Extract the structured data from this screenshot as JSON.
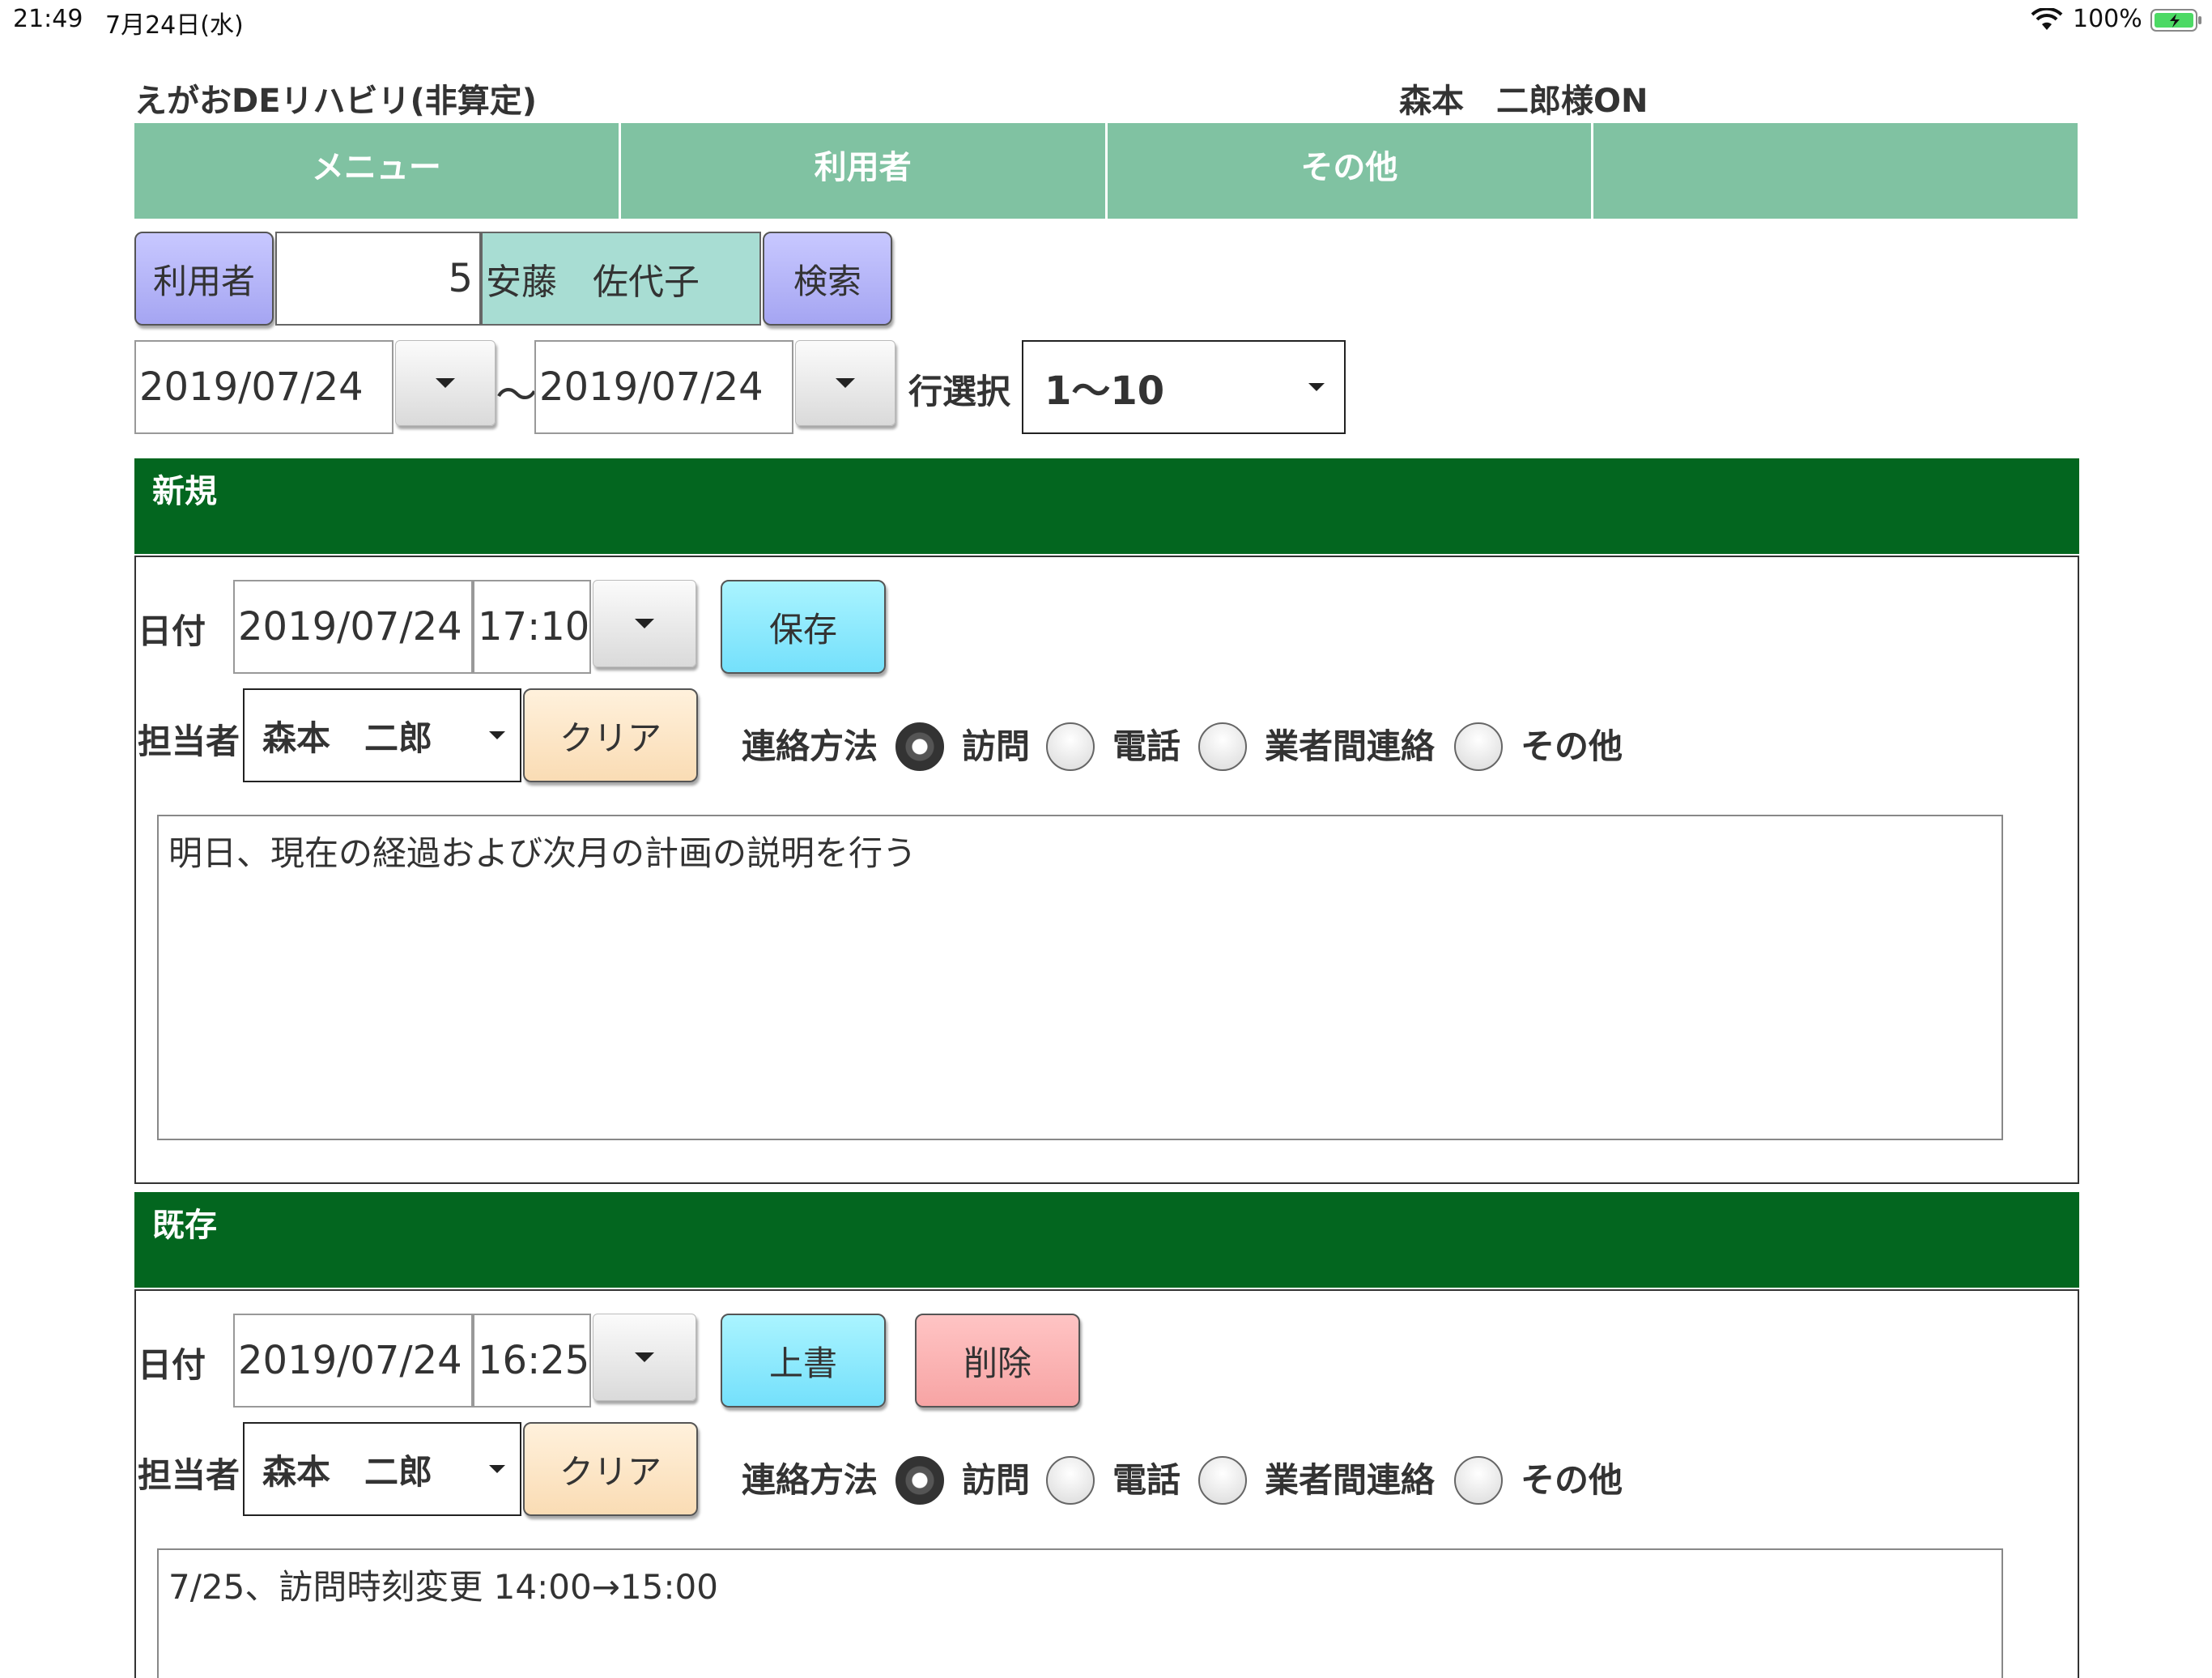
{
  "status_bar": {
    "time": "21:49",
    "date": "7月24日(水)",
    "battery": "100%"
  },
  "header": {
    "app_title": "えがおDEリハビリ(非算定)",
    "user_status": "森本　二郎様ON"
  },
  "tabs": [
    "メニュー",
    "利用者",
    "その他",
    ""
  ],
  "search": {
    "user_button": "利用者",
    "user_id": "5",
    "user_name": "安藤　佐代子",
    "search_button": "検索",
    "date_from": "2019/07/24",
    "tilde": "〜",
    "date_to": "2019/07/24",
    "row_select_label": "行選択",
    "row_select_value": "1〜10"
  },
  "new_section": {
    "title": "新規",
    "date_label": "日付",
    "date": "2019/07/24",
    "time": "17:10",
    "save_button": "保存",
    "staff_label": "担当者",
    "staff": "森本　二郎",
    "clear_button": "クリア",
    "contact_label": "連絡方法",
    "contact_options": [
      "訪問",
      "電話",
      "業者間連絡",
      "その他"
    ],
    "memo": "明日、現在の経過および次月の計画の説明を行う"
  },
  "existing_section": {
    "title": "既存",
    "date_label": "日付",
    "date": "2019/07/24",
    "time": "16:25",
    "overwrite_button": "上書",
    "delete_button": "削除",
    "staff_label": "担当者",
    "staff": "森本　二郎",
    "clear_button": "クリア",
    "contact_label": "連絡方法",
    "contact_options": [
      "訪問",
      "電話",
      "業者間連絡",
      "その他"
    ],
    "memo": "7/25、訪問時刻変更 14:00→15:00"
  },
  "colors": {
    "tab_bar": "#80c2a2",
    "section_bar": "#03661f",
    "name_field": "#a8ddd3",
    "search_button": "#b5b5f7",
    "save_button": "#8ce9fd",
    "delete_button": "#f9b3b3",
    "clear_button": "#fde6c6"
  }
}
